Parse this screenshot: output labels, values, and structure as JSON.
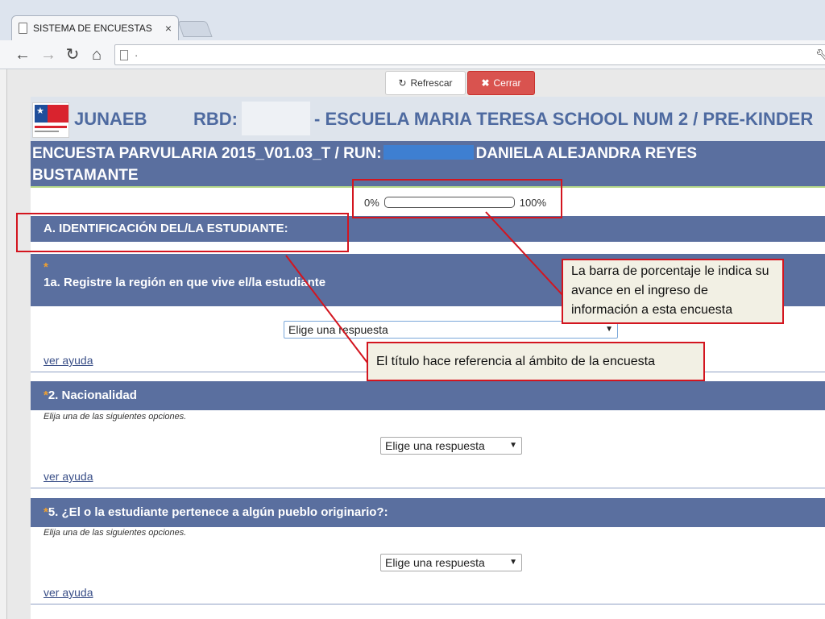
{
  "browser": {
    "tab_title": "SISTEMA DE ENCUESTAS",
    "tab_close": "×",
    "address": "·",
    "back_glyph": "←",
    "forward_glyph": "→",
    "reload_glyph": "↻",
    "home_glyph": "⌂"
  },
  "actions": {
    "refresh_label": "Refrescar",
    "close_label": "Cerrar"
  },
  "header": {
    "org": "JUNAEB",
    "rbd_label": "RBD:",
    "school": "- ESCUELA MARIA TERESA SCHOOL NUM 2 / PRE-KINDER"
  },
  "survey": {
    "title": "ENCUESTA PARVULARIA 2015_V01.03_T / RUN:",
    "student_first": "DANIELA ALEJANDRA REYES",
    "student_last": "BUSTAMANTE"
  },
  "progress": {
    "min_label": "0%",
    "max_label": "100%",
    "value": 0
  },
  "section": {
    "title": "A. IDENTIFICACIÓN DEL/LA ESTUDIANTE:"
  },
  "questions": [
    {
      "asterisk": "*",
      "label": "1a. Registre la región en que vive el/la estudiante",
      "hint": "",
      "select_value": "Elige una respuesta",
      "help_link": "ver ayuda"
    },
    {
      "asterisk": "*",
      "label": "2. Nacionalidad",
      "hint": "Elija una de las siguientes opciones.",
      "select_value": "Elige una respuesta",
      "help_link": "ver ayuda"
    },
    {
      "asterisk": "*",
      "label": "5. ¿El o la estudiante pertenece a algún pueblo originario?:",
      "hint": "Elija una de las siguientes opciones.",
      "select_value": "Elige una respuesta",
      "help_link": "ver ayuda"
    }
  ],
  "annotations": {
    "progress_note": "La barra de porcentaje le indica su avance en el ingreso de información a esta encuesta",
    "title_note": "El título hace referencia al ámbito de la encuesta"
  },
  "colors": {
    "header_blue": "#5a6f9f",
    "annotation_red": "#d3151f",
    "close_button": "#d9534f"
  }
}
